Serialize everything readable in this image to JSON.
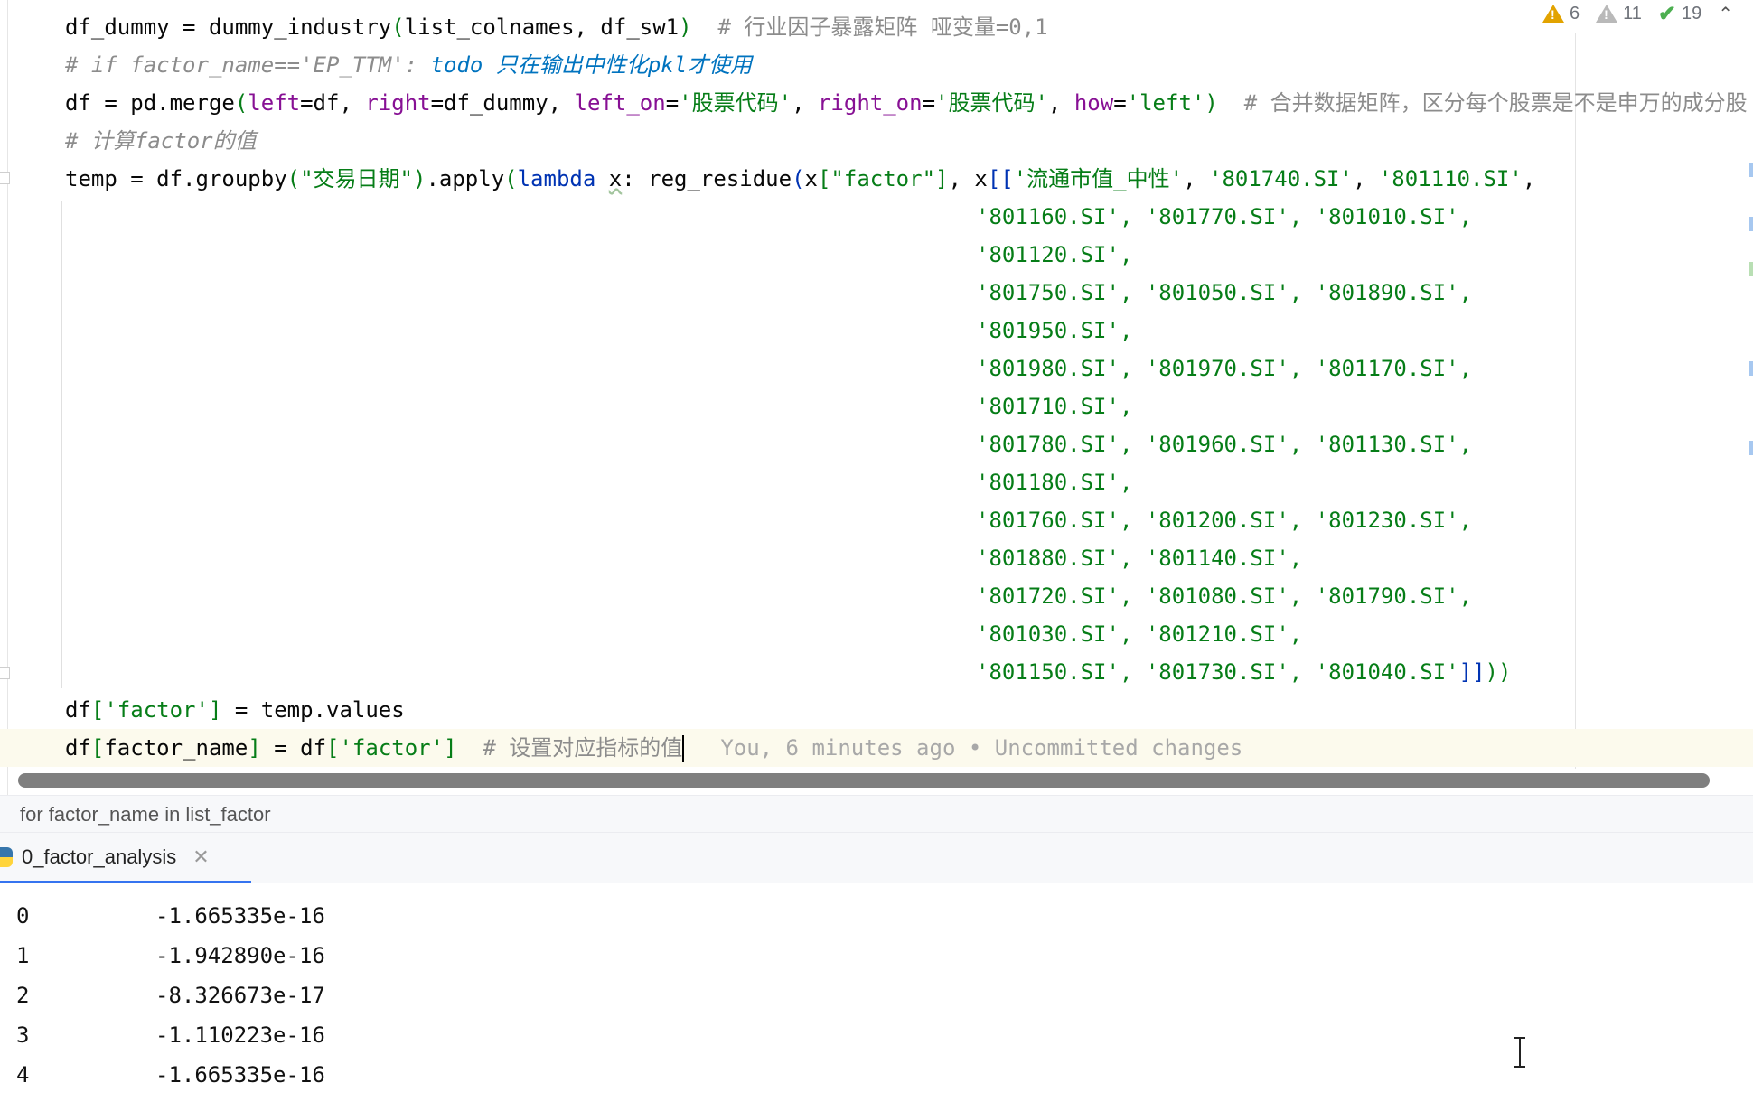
{
  "editor": {
    "lines": {
      "l1": {
        "a": "df_dummy = dummy_industry",
        "b": "(",
        "c": "list_colnames, df_sw1",
        "d": ")",
        "e": "  # 行业因子暴露矩阵 哑变量=0,1"
      },
      "l2": {
        "a": "# if factor_name=='EP_TTM': ",
        "todo": "todo 只在输出中性化pkl才使用"
      },
      "l3": {
        "a": "df = pd.merge",
        "b": "(",
        "c1": "left",
        "c2": "=df, ",
        "c3": "right",
        "c4": "=df_dummy, ",
        "c5": "left_on",
        "c6": "=",
        "c7": "'股票代码'",
        "c8": ", ",
        "c9": "right_on",
        "c10": "=",
        "c11": "'股票代码'",
        "c12": ", ",
        "c13": "how",
        "c14": "=",
        "c15": "'left'",
        "d": ")",
        "e": "  # 合并数据矩阵，区分每个股票是不是申万的成分股"
      },
      "l4": {
        "a": "# 计算factor的值"
      },
      "l5": {
        "a": "temp = df.groupby",
        "b": "(",
        "s1": "\"交易日期\"",
        "d": ")",
        "e": ".apply",
        "f": "(",
        "g": "lambda",
        "h": " ",
        "x": "x",
        "i": ": reg_residue",
        "j": "(",
        "k": "x",
        "l": "[",
        "s2": "\"factor\"",
        "m": "]",
        "n": ", x",
        "o": "[[",
        "s3": "'流通市值_中性'",
        "q": ", ",
        "s4": "'801740.SI'",
        "r": ", ",
        "s5": "'801110.SI'",
        "t": ","
      },
      "cont": [
        "'801160.SI', '801770.SI', '801010.SI',",
        "'801120.SI',",
        "'801750.SI', '801050.SI', '801890.SI',",
        "'801950.SI',",
        "'801980.SI', '801970.SI', '801170.SI',",
        "'801710.SI',",
        "'801780.SI', '801960.SI', '801130.SI',",
        "'801180.SI',",
        "'801760.SI', '801200.SI', '801230.SI',",
        "'801880.SI', '801140.SI',",
        "'801720.SI', '801080.SI', '801790.SI',",
        "'801030.SI', '801210.SI',"
      ],
      "last_cont": {
        "a": "'801150.SI', '801730.SI', '801040.SI'",
        "b": "]]",
        "c": "))"
      },
      "l19": {
        "a": "df",
        "b": "[",
        "s": "'factor'",
        "c": "]",
        "d": " = temp.values"
      },
      "l20": {
        "a": "df",
        "b": "[",
        "c": "factor_name",
        "d": "]",
        "e": " = df",
        "f": "[",
        "s": "'factor'",
        "g": "]",
        "h": "  # 设置对应指标的值",
        "blame": "You, 6 minutes ago • Uncommitted changes"
      }
    }
  },
  "inspections": {
    "warnings": "6",
    "weak_warnings": "11",
    "ok": "19",
    "icons": [
      "warning-icon",
      "weak-warning-icon",
      "check-icon",
      "chevron-up-icon"
    ]
  },
  "breadcrumb": "for factor_name in list_factor",
  "run_tab": {
    "label": "0_factor_analysis"
  },
  "console": {
    "rows": [
      {
        "index": "0",
        "value": "-1.665335e-16"
      },
      {
        "index": "1",
        "value": "-1.942890e-16"
      },
      {
        "index": "2",
        "value": "-8.326673e-17"
      },
      {
        "index": "3",
        "value": "-1.110223e-16"
      },
      {
        "index": "4",
        "value": "-1.665335e-16"
      }
    ]
  },
  "colors": {
    "keyword": "#0033b3",
    "param": "#871094",
    "string": "#067d17",
    "comment": "#8c8c8c",
    "todo": "#0073bf",
    "current_line": "#fcfaed",
    "tab_underline": "#3574f0"
  }
}
